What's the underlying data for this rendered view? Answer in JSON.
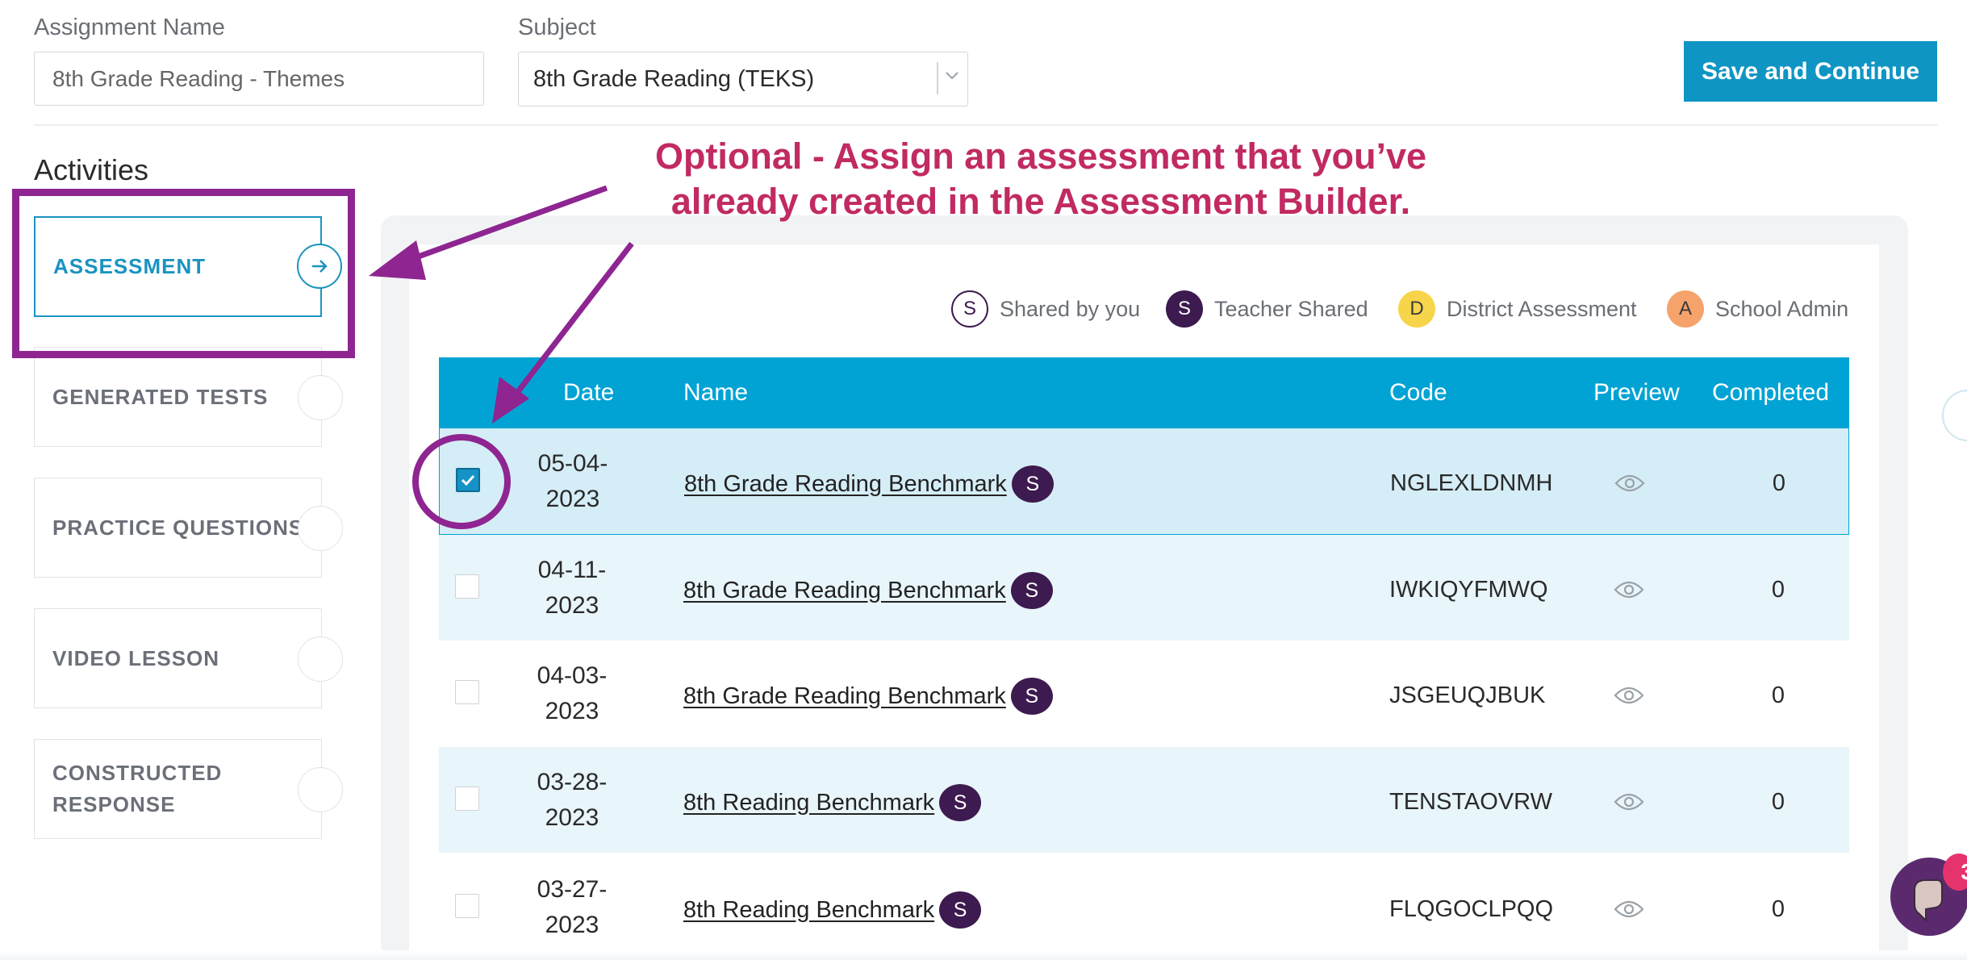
{
  "header": {
    "assignment_name_label": "Assignment Name",
    "assignment_name_value": "8th Grade Reading - Themes",
    "subject_label": "Subject",
    "subject_value": "8th Grade Reading (TEKS)",
    "save_label": "Save and Continue"
  },
  "sidebar": {
    "title": "Activities",
    "items": [
      {
        "label": "ASSESSMENT"
      },
      {
        "label": "GENERATED TESTS"
      },
      {
        "label": "PRACTICE QUESTIONS"
      },
      {
        "label": "VIDEO LESSON"
      },
      {
        "label": "CONSTRUCTED RESPONSE"
      }
    ]
  },
  "legend": [
    {
      "badge": "S",
      "label": "Shared by you"
    },
    {
      "badge": "S",
      "label": "Teacher Shared"
    },
    {
      "badge": "D",
      "label": "District Assessment"
    },
    {
      "badge": "A",
      "label": "School Admin"
    }
  ],
  "table": {
    "columns": [
      "Date",
      "Name",
      "Code",
      "Preview",
      "Completed"
    ],
    "rows": [
      {
        "date_line1": "05-04-",
        "date_line2": "2023",
        "name": "8th Grade Reading Benchmark",
        "badge": "S",
        "code": "NGLEXLDNMH",
        "completed": "0",
        "selected": true
      },
      {
        "date_line1": "04-11-",
        "date_line2": "2023",
        "name": "8th Grade Reading Benchmark",
        "badge": "S",
        "code": "IWKIQYFMWQ",
        "completed": "0",
        "selected": false
      },
      {
        "date_line1": "04-03-",
        "date_line2": "2023",
        "name": "8th Grade Reading Benchmark",
        "badge": "S",
        "code": "JSGEUQJBUK",
        "completed": "0",
        "selected": false
      },
      {
        "date_line1": "03-28-",
        "date_line2": "2023",
        "name": "8th Reading Benchmark",
        "badge": "S",
        "code": "TENSTAOVRW",
        "completed": "0",
        "selected": false
      },
      {
        "date_line1": "03-27-",
        "date_line2": "2023",
        "name": "8th Reading Benchmark",
        "badge": "S",
        "code": "FLQGOCLPQQ",
        "completed": "0",
        "selected": false
      }
    ]
  },
  "annotation": {
    "line1": "Optional - Assign an assessment that you’ve",
    "line2": "already created in the Assessment Builder."
  },
  "chat": {
    "badge_count": "3"
  },
  "colors": {
    "accent": "#0e95c4",
    "table_header": "#00a3d4",
    "annotation_purple": "#8e2591",
    "annotation_text": "#c12a63",
    "badge_dark": "#3d1a4f",
    "badge_district": "#f7d54a",
    "badge_admin": "#f5a36a"
  }
}
